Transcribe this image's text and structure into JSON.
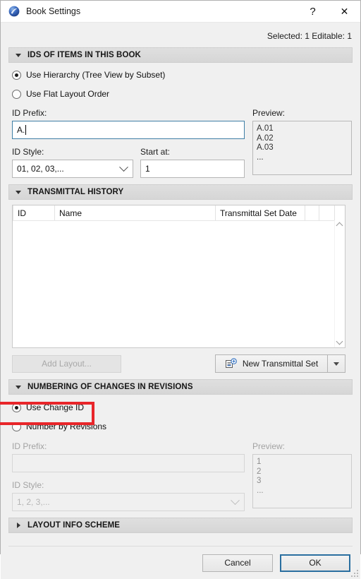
{
  "window": {
    "title": "Book Settings",
    "app_icon": "archicad-sphere-icon",
    "help_label": "?",
    "close_label": "✕"
  },
  "status": {
    "text": "Selected: 1 Editable: 1"
  },
  "colors": {
    "accent": "#2a6fa0",
    "highlight": "#e8262a",
    "dialog_bg": "#f0f0f0",
    "section_bg": "#d8d8d8"
  },
  "sections": {
    "ids_of_items": {
      "title": "IDS OF ITEMS IN THIS BOOK",
      "expanded": true,
      "radios": [
        {
          "label": "Use Hierarchy (Tree View by Subset)",
          "checked": true
        },
        {
          "label": "Use Flat Layout Order",
          "checked": false
        }
      ],
      "id_prefix_label": "ID Prefix:",
      "id_prefix_value": "A.",
      "id_prefix_placeholder": "",
      "id_style_label": "ID Style:",
      "id_style_value": "01, 02, 03,...",
      "start_at_label": "Start at:",
      "start_at_value": "1",
      "preview_label": "Preview:",
      "preview_lines": [
        "A.01",
        "A.02",
        "A.03",
        "..."
      ]
    },
    "transmittal_history": {
      "title": "TRANSMITTAL HISTORY",
      "expanded": true,
      "columns": [
        "ID",
        "Name",
        "Transmittal Set Date",
        "",
        ""
      ],
      "rows": [],
      "add_layout_label": "Add Layout...",
      "add_layout_enabled": false,
      "new_transmittal_label": "New Transmittal Set",
      "new_transmittal_icon": "new-transmittal-set-icon"
    },
    "numbering_of_changes": {
      "title": "NUMBERING OF CHANGES IN REVISIONS",
      "expanded": true,
      "radios": [
        {
          "label": "Use Change ID",
          "checked": true,
          "highlighted": true
        },
        {
          "label": "Number by Revisions",
          "checked": false,
          "highlighted": false
        }
      ],
      "id_prefix_label": "ID Prefix:",
      "id_prefix_value": "",
      "id_style_label": "ID Style:",
      "id_style_value": "1, 2, 3,...",
      "preview_label": "Preview:",
      "preview_lines": [
        "1",
        "2",
        "3",
        "..."
      ],
      "disabled": true
    },
    "layout_info_scheme": {
      "title": "LAYOUT INFO SCHEME",
      "expanded": false
    }
  },
  "footer": {
    "cancel_label": "Cancel",
    "ok_label": "OK"
  }
}
